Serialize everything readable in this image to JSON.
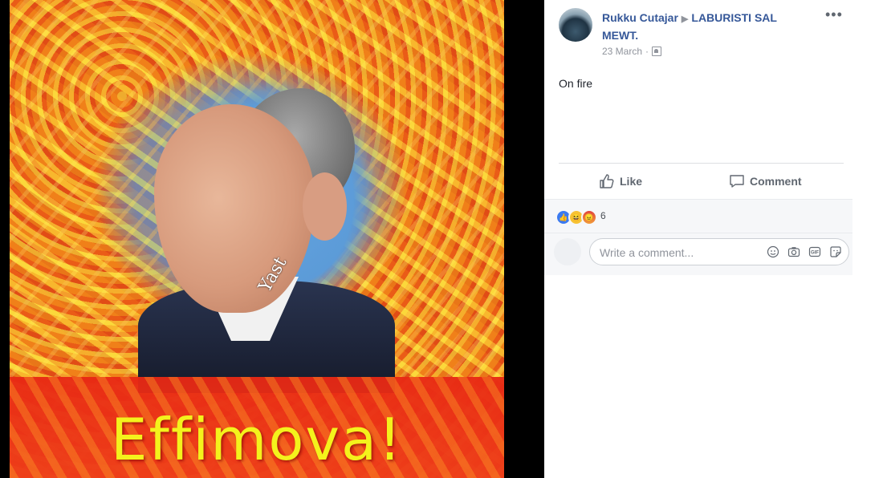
{
  "image": {
    "caption": "Effimova!",
    "watermark": "Yast"
  },
  "post": {
    "author": "Rukku Cutajar",
    "group": "LABURISTI SAL MEWT.",
    "date": "23 March",
    "separator": "·",
    "text": "On fire",
    "more_label": "•••"
  },
  "actions": {
    "like_label": "Like",
    "comment_label": "Comment"
  },
  "reactions": {
    "count": "6",
    "types": [
      "like",
      "haha",
      "angry"
    ]
  },
  "comment_box": {
    "placeholder": "Write a comment...",
    "tools": [
      "emoji-icon",
      "camera-icon",
      "gif-icon",
      "sticker-icon"
    ]
  },
  "colors": {
    "link": "#365899",
    "muted": "#90949c",
    "caption_text": "#f4f21c",
    "caption_band": "#e8281c"
  }
}
